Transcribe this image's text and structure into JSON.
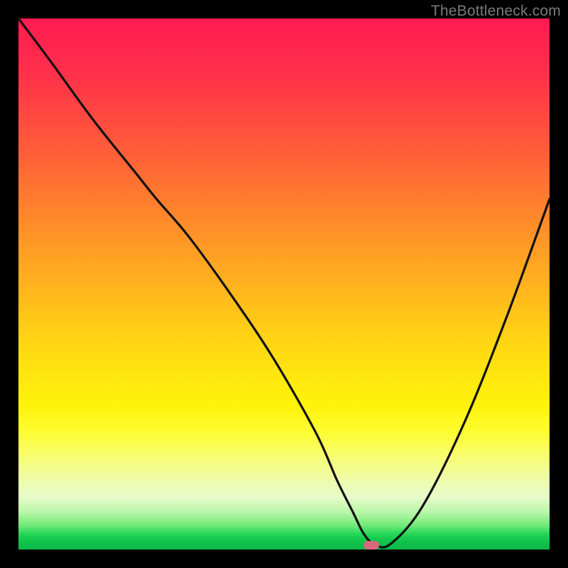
{
  "watermark": "TheBottleneck.com",
  "colors": {
    "frame": "#000000",
    "curve_stroke": "#111111",
    "marker_fill": "#d9697e"
  },
  "chart_data": {
    "type": "line",
    "title": "",
    "xlabel": "",
    "ylabel": "",
    "xlim": [
      0,
      100
    ],
    "ylim": [
      0,
      100
    ],
    "grid": false,
    "legend": null,
    "series": [
      {
        "name": "bottleneck-curve",
        "x": [
          0,
          6,
          14,
          22,
          26,
          32,
          40,
          48,
          56,
          60,
          63,
          65,
          67,
          70,
          76,
          84,
          92,
          100
        ],
        "y": [
          100,
          92,
          81,
          71,
          66,
          59,
          48,
          36,
          22,
          13,
          7,
          3,
          1,
          1,
          8,
          24,
          44,
          66
        ]
      }
    ],
    "annotations": [
      {
        "name": "optimal-marker",
        "x": 66.5,
        "y": 0.8
      }
    ]
  }
}
